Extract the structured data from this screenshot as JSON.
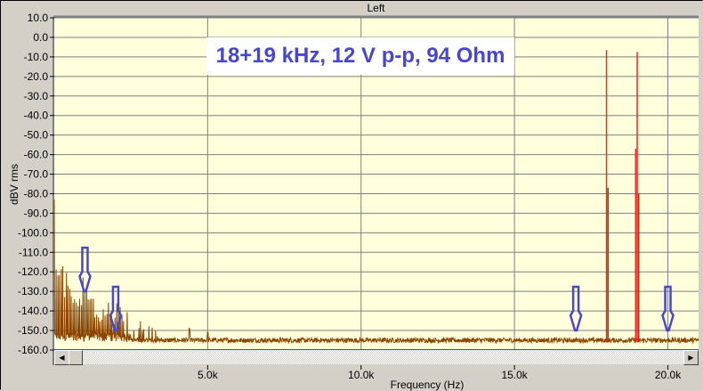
{
  "window": {
    "title": "Left"
  },
  "annotation": "18+19 kHz, 12 V p-p, 94 Ohm",
  "colors": {
    "plot_bg": "#ffffdc",
    "grid": "#808080",
    "trace": "#8b4500",
    "peak": "#ff2020",
    "arrow": "#4646d2",
    "baseline": "#0000ff"
  },
  "chart_data": {
    "type": "line",
    "title": "Left",
    "xlabel": "Frequency (Hz)",
    "ylabel": "dBV rms",
    "xlim": [
      0,
      21000
    ],
    "ylim": [
      -160,
      10
    ],
    "grid": true,
    "yticks": [
      "10.0",
      "0.0",
      "-10.0",
      "-20.0",
      "-30.0",
      "-40.0",
      "-50.0",
      "-60.0",
      "-70.0",
      "-80.0",
      "-90.0",
      "-100.0",
      "-110.0",
      "-120.0",
      "-130.0",
      "-140.0",
      "-150.0",
      "-160.0"
    ],
    "yvalues": [
      10,
      0,
      -10,
      -20,
      -30,
      -40,
      -50,
      -60,
      -70,
      -80,
      -90,
      -100,
      -110,
      -120,
      -130,
      -140,
      -150,
      -160
    ],
    "xticks": [
      "5.0k",
      "10.0k",
      "15.0k",
      "20.0k"
    ],
    "xvalues": [
      5000,
      10000,
      15000,
      20000
    ],
    "noise_floor_dbv": -155,
    "dc_level_dbv": -83,
    "peaks": [
      {
        "name": "18 kHz tone",
        "freq": 18000,
        "level": -6.5,
        "color": "red"
      },
      {
        "name": "19 kHz tone",
        "freq": 19000,
        "level": -7.5,
        "color": "red"
      },
      {
        "name": "19 kHz side",
        "freq": 18950,
        "level": -57,
        "color": "red"
      },
      {
        "name": "18 kHz brown",
        "freq": 18050,
        "level": -77,
        "color": "brown"
      },
      {
        "name": "19 kHz brown",
        "freq": 19050,
        "level": -80,
        "color": "brown"
      }
    ],
    "arrows": [
      {
        "freq": 1000,
        "tip_level": -130
      },
      {
        "freq": 2000,
        "tip_level": -150
      },
      {
        "freq": 17000,
        "tip_level": -150
      },
      {
        "freq": 20000,
        "tip_level": -150
      }
    ]
  }
}
